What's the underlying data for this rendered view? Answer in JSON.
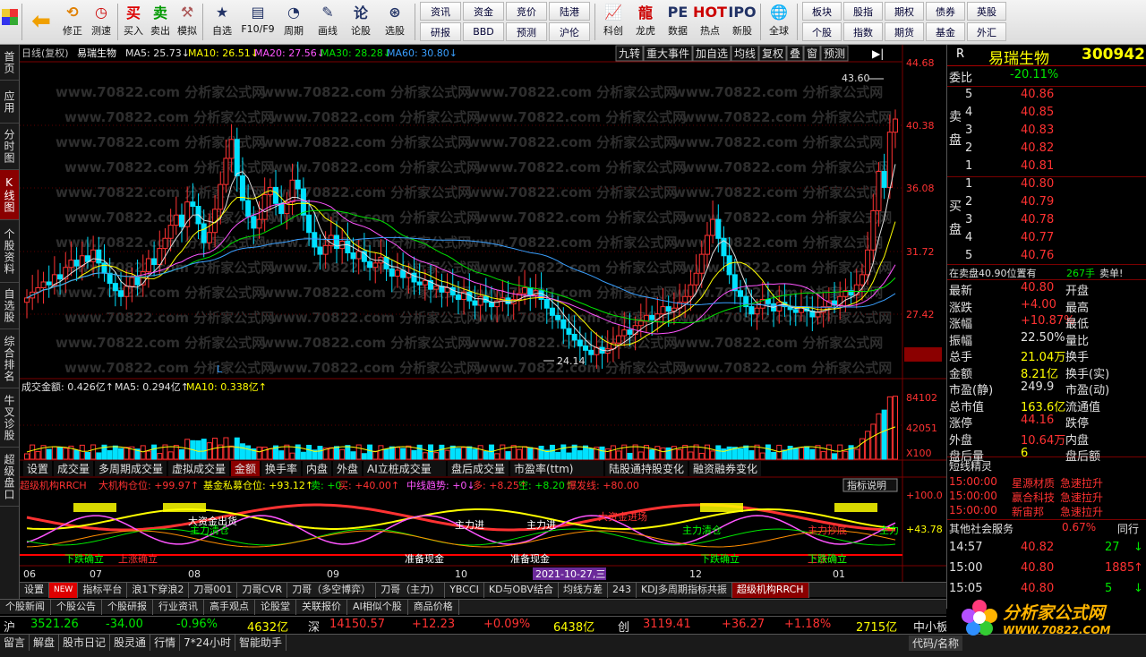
{
  "toolbar": {
    "buttons": [
      {
        "label": "后退",
        "icon": "back-arrow-icon"
      },
      {
        "label": "修正",
        "icon": "refresh-icon"
      },
      {
        "label": "测速",
        "icon": "clock-icon"
      },
      {
        "label": "买入",
        "icon": "buy-icon"
      },
      {
        "label": "卖出",
        "icon": "sell-icon"
      },
      {
        "label": "模拟",
        "icon": "hammer-icon"
      },
      {
        "label": "自选",
        "icon": "star-icon"
      },
      {
        "label": "F10/F9",
        "icon": "f10-icon"
      },
      {
        "label": "周期",
        "icon": "cycle-icon"
      },
      {
        "label": "画线",
        "icon": "pen-icon"
      },
      {
        "label": "论股",
        "icon": "discuss-icon"
      },
      {
        "label": "选股",
        "icon": "select-stock-icon"
      }
    ],
    "grid1": [
      "资讯",
      "资金",
      "竞价",
      "陆港",
      "研报",
      "BBD",
      "预测",
      "沪伦"
    ],
    "buttons2": [
      {
        "label": "科创"
      },
      {
        "label": "龙虎"
      },
      {
        "label": "数据"
      },
      {
        "label": "热点"
      },
      {
        "label": "新股"
      },
      {
        "label": "全球"
      }
    ],
    "grid2": [
      "板块",
      "股指",
      "期权",
      "债券",
      "英股",
      "个股",
      "指数",
      "期货",
      "基金",
      "外汇"
    ]
  },
  "leftnav": [
    "首页",
    "应用",
    "分时图",
    "K线图",
    "个股资料",
    "自选股",
    "综合排名",
    "牛叉诊股",
    "超级盘口"
  ],
  "chart": {
    "header": {
      "period": "日线(复权)",
      "name": "易瑞生物",
      "ma5": "MA5: 25.73↓",
      "ma10": "MA10: 26.51↓",
      "ma20": "MA20: 27.56↓",
      "ma30": "MA30: 28.28↓",
      "ma60": "MA60: 30.80↓"
    },
    "toolbtns": [
      "九转",
      "重大事件",
      "加自选",
      "均线",
      "复权",
      "叠",
      "窗",
      "预测"
    ],
    "yaxis": [
      "44.68",
      "40.38",
      "36.08",
      "31.72",
      "27.42",
      "24.49"
    ],
    "high_label": "43.60",
    "low_label": "24.14",
    "watermark": "www.70822.com  分析家公式网",
    "vol_header": {
      "amt": "成交金额: 0.426亿↑",
      "ma5": "MA5: 0.294亿↑",
      "ma10": "MA10: 0.338亿↑"
    },
    "vol_axis": [
      "84102",
      "42051",
      "X100"
    ],
    "subtabs": [
      "设置",
      "成交量",
      "多周期成交量",
      "虚拟成交量",
      "金额",
      "换手率",
      "内盘",
      "外盘",
      "AI立桩成交量",
      "盘后成交量",
      "市盈率(ttm)",
      "陆股通持股变化",
      "融资融券变化"
    ],
    "ind_header": {
      "name": "超级机构RRCH",
      "a": "大机构仓位: +99.97↑",
      "b": "基金私募仓位: +93.12↑",
      "c": "卖: +0",
      "d": "买: +40.00↑",
      "e": "中线趋势: +0↓",
      "f": "多: +8.25↑",
      "g": "空: +8.20↑",
      "h": "爆发线: +80.00"
    },
    "ind_btn": "指标说明",
    "ind_axis": [
      "+100.0",
      "+43.78"
    ],
    "ind_labels": [
      {
        "t": "大资金出货",
        "c": "#ffffff"
      },
      {
        "t": "主力清仓",
        "c": "#00ff00"
      },
      {
        "t": "下跌确立",
        "c": "#00ff00"
      },
      {
        "t": "上涨确立",
        "c": "#ff3232"
      },
      {
        "t": "主力进",
        "c": "#ffffff"
      },
      {
        "t": "主力进",
        "c": "#ffffff"
      },
      {
        "t": "准备现金",
        "c": "#ffffff"
      },
      {
        "t": "准备现金",
        "c": "#ffffff"
      },
      {
        "t": "大资金进场",
        "c": "#ff3232"
      },
      {
        "t": "主力清仓",
        "c": "#00ff00"
      },
      {
        "t": "下跌确立",
        "c": "#00ff00"
      },
      {
        "t": "主力抄底",
        "c": "#ff3232"
      },
      {
        "t": "上涨确立",
        "c": "#ff3232"
      },
      {
        "t": "主力",
        "c": "#00ff00"
      },
      {
        "t": "下跌确立",
        "c": "#00ff00"
      }
    ],
    "xaxis": [
      "06",
      "07",
      "08",
      "09",
      "10",
      "12",
      "01"
    ],
    "date_badge": "2021-10-27,三"
  },
  "chart_data": {
    "type": "candlestick",
    "title": "易瑞生物",
    "price_range": [
      24.14,
      43.6
    ],
    "high": 43.6,
    "low": 24.14,
    "close": 40.8,
    "series": [
      {
        "name": "MA5",
        "value": 25.73
      },
      {
        "name": "MA10",
        "value": 26.51
      },
      {
        "name": "MA20",
        "value": 27.56
      },
      {
        "name": "MA30",
        "value": 28.28
      },
      {
        "name": "MA60",
        "value": 30.8
      }
    ],
    "x_ticks": [
      "06",
      "07",
      "08",
      "09",
      "10",
      "12",
      "01"
    ],
    "y_ticks": [
      44.68,
      40.38,
      36.08,
      31.72,
      27.42
    ],
    "last_price_marker": 24.49
  },
  "right": {
    "title": "易瑞生物",
    "code": "300942",
    "r": "R",
    "weibi": {
      "label": "委比",
      "value": "-20.11%"
    },
    "sell_label": "卖盘",
    "buy_label": "买盘",
    "sells": [
      {
        "n": "5",
        "p": "40.86"
      },
      {
        "n": "4",
        "p": "40.85"
      },
      {
        "n": "3",
        "p": "40.83"
      },
      {
        "n": "2",
        "p": "40.82"
      },
      {
        "n": "1",
        "p": "40.81"
      }
    ],
    "buys": [
      {
        "n": "1",
        "p": "40.80"
      },
      {
        "n": "2",
        "p": "40.79"
      },
      {
        "n": "3",
        "p": "40.78"
      },
      {
        "n": "4",
        "p": "40.77"
      },
      {
        "n": "5",
        "p": "40.76"
      }
    ],
    "notice": {
      "a": "在卖盘40.90位置有",
      "b": "267手",
      "c": "卖单!"
    },
    "quote": [
      {
        "l": "最新",
        "v": "40.80",
        "l2": "开盘",
        "c": "red"
      },
      {
        "l": "涨跌",
        "v": "+4.00",
        "l2": "最高",
        "c": "red"
      },
      {
        "l": "涨幅",
        "v": "+10.87%",
        "l2": "最低",
        "c": "red"
      },
      {
        "l": "振幅",
        "v": "22.50%",
        "l2": "量比",
        "c": "wht"
      },
      {
        "l": "总手",
        "v": "21.04万",
        "l2": "换手",
        "c": "yel"
      },
      {
        "l": "金额",
        "v": "8.21亿",
        "l2": "换手(实)",
        "c": "yel"
      },
      {
        "l": "市盈(静)",
        "v": "249.9",
        "l2": "市盈(动)",
        "c": "wht"
      },
      {
        "l": "总市值",
        "v": "163.6亿",
        "l2": "流通值",
        "c": "yel"
      },
      {
        "l": "涨停",
        "v": "44.16",
        "l2": "跌停",
        "c": "red"
      },
      {
        "l": "外盘",
        "v": "10.64万",
        "l2": "内盘",
        "c": "red"
      },
      {
        "l": "盘后量",
        "v": "6",
        "l2": "盘后额",
        "c": "yel"
      }
    ],
    "short_title": "短线精灵",
    "short": [
      {
        "t": "15:00:00",
        "n": "星源材质",
        "a": "急速拉升"
      },
      {
        "t": "15:00:00",
        "n": "赢合科技",
        "a": "急速拉升"
      },
      {
        "t": "15:00:00",
        "n": "新宙邦",
        "a": "急速拉升"
      }
    ],
    "other": {
      "label": "其他社会服务",
      "pct": "0.67%",
      "tail": "同行"
    },
    "ticks": [
      {
        "t": "14:57",
        "p": "40.82",
        "v": "27",
        "d": "down"
      },
      {
        "t": "15:00",
        "p": "40.80",
        "v": "1885",
        "d": "up"
      },
      {
        "t": "15:05",
        "p": "40.80",
        "v": "5",
        "d": "down"
      }
    ]
  },
  "tabs1": [
    "设置",
    "NEW",
    "指标平台",
    "浪1下穿浪2",
    "刀哥001",
    "刀哥CVR",
    "刀哥（多空博弈）",
    "刀哥（主力）",
    "YBCCI",
    "KD与OBV结合",
    "均线方差",
    "243",
    "KDJ多周期指标共振",
    "超级机构RRCH"
  ],
  "tabs2": [
    "个股新闻",
    "个股公告",
    "个股研报",
    "行业资讯",
    "高手观点",
    "论股堂",
    "关联报价",
    "AI相似个股",
    "商品价格"
  ],
  "index": {
    "sh_label": "沪",
    "sh": "3521.26",
    "sh_chg": "-34.00",
    "sh_pct": "-0.96%",
    "sh_amt": "4632亿",
    "sz_label": "深",
    "sz": "14150.57",
    "sz_chg": "+12.23",
    "sz_pct": "+0.09%",
    "sz_amt": "6438亿",
    "cy_label": "创",
    "cy": "3119.41",
    "cy_chg": "+36.27",
    "cy_pct": "+1.18%",
    "cy_amt": "2715亿",
    "zx": "中小板"
  },
  "status": [
    "留言",
    "解盘",
    "股市日记",
    "股灵通",
    "行情",
    "7*24小时",
    "智能助手"
  ],
  "status_right": "代码/名称",
  "logo": {
    "a": "分析家公式网",
    "b": "WWW.70822.COM"
  }
}
